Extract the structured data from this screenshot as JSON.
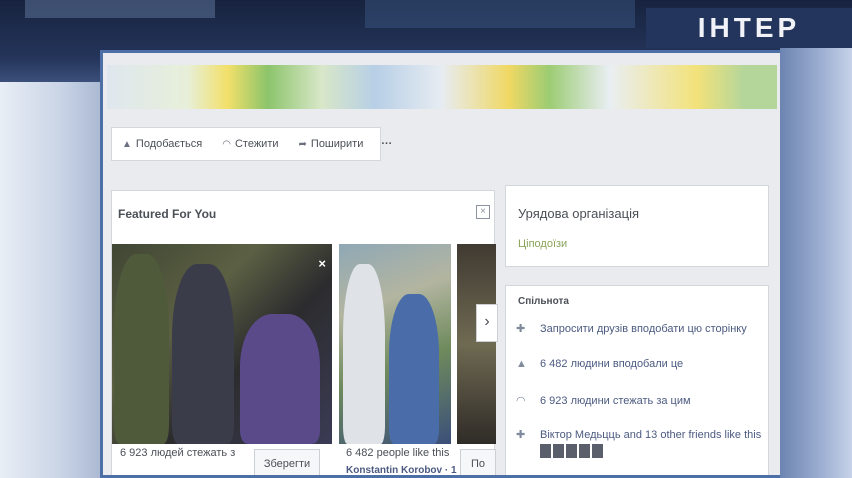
{
  "broadcast": {
    "channel_logo": "ІНТЕР"
  },
  "action_bar": {
    "like": "Подобається",
    "follow": "Стежити",
    "share": "Поширити",
    "more": "···"
  },
  "featured": {
    "title": "Featured For You",
    "close": "×",
    "cards": [
      {
        "caption": "6 923 людей стежать з",
        "button": "Зберегти",
        "close": "×"
      },
      {
        "caption": "6 482 people like this",
        "subcaption": "Konstantin Korobov · 1",
        "button": "По"
      }
    ],
    "next": "›"
  },
  "page_info": {
    "category": "Урядова організація",
    "status": "Ціподоїзи"
  },
  "community": {
    "title": "Спільнота",
    "items": [
      {
        "icon": "invite-icon",
        "text": "Запросити друзів вподобати цю сторінку"
      },
      {
        "icon": "like-icon",
        "text": "6 482 людини вподобали це"
      },
      {
        "icon": "rss-icon",
        "text": "6 923 людини стежать за цим"
      },
      {
        "icon": "friends-icon",
        "text": "Віктор Медьцць and 13 other friends like this"
      }
    ]
  },
  "colors": {
    "frame": "#4c6fa6",
    "link": "#4b5a80",
    "panel": "#ffffff",
    "bg": "#e9ebee"
  }
}
